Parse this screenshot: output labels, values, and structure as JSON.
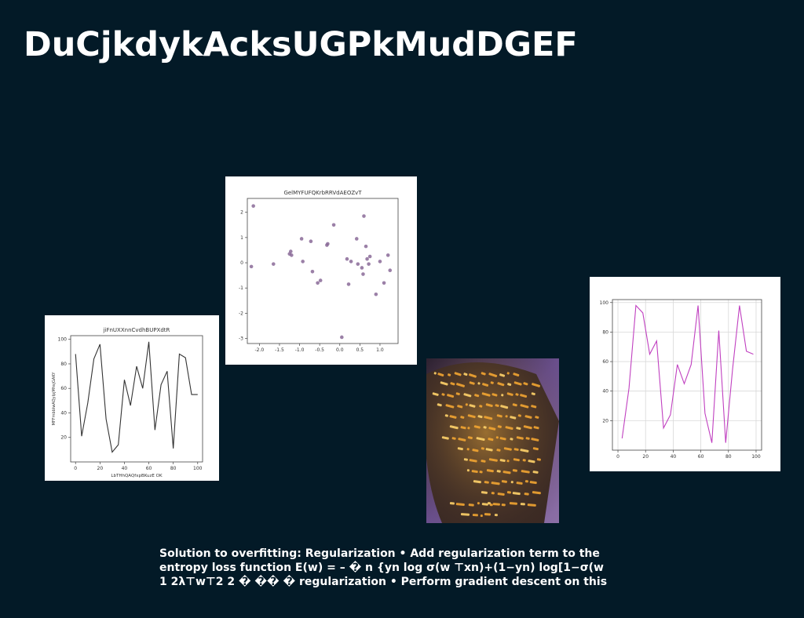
{
  "slide": {
    "title": "DuCjkdykAcksUGPkMudDGEF",
    "caption_lines": [
      "Solution to overfitting: Regularization • Add regularization term to the",
      "entropy loss function E(w) = – � n {yn log σ(w ⊤xn)+(1−yn) log[1−σ(w",
      "1 2λ⊤w⊤2 2 � �� � regularization • Perform gradient descent on this"
    ]
  },
  "chart_data": [
    {
      "type": "scatter",
      "title": "GelMYFUFQKrbRRVdAEOZvT",
      "xlabel": "",
      "ylabel": "",
      "xlim": [
        -2.3,
        1.45
      ],
      "ylim": [
        -3.2,
        2.55
      ],
      "xticks": [
        "-2.0",
        "-1.5",
        "-1.0",
        "-0.5",
        "0.0",
        "0.5",
        "1.0"
      ],
      "xtick_values": [
        -2.0,
        -1.5,
        -1.0,
        -0.5,
        0.0,
        0.5,
        1.0
      ],
      "yticks": [
        "2",
        "1",
        "0",
        "-1",
        "-2",
        "-3"
      ],
      "ytick_values": [
        2,
        1,
        0,
        -1,
        -2,
        -3
      ],
      "color": "#8a6a98",
      "x": [
        -2.15,
        -2.2,
        -1.65,
        -1.25,
        -1.22,
        -1.2,
        -0.95,
        -0.92,
        -0.72,
        -0.68,
        -0.55,
        -0.48,
        -0.32,
        -0.3,
        -0.15,
        0.05,
        0.18,
        0.22,
        0.28,
        0.42,
        0.45,
        0.55,
        0.58,
        0.6,
        0.65,
        0.68,
        0.72,
        0.75,
        0.9,
        1.0,
        1.1,
        1.2,
        1.25
      ],
      "y": [
        2.25,
        -0.15,
        -0.05,
        0.35,
        0.45,
        0.3,
        0.95,
        0.05,
        0.85,
        -0.35,
        -0.8,
        -0.7,
        0.7,
        0.75,
        1.5,
        -2.95,
        0.15,
        -0.85,
        0.05,
        0.95,
        -0.05,
        -0.2,
        -0.45,
        1.85,
        0.65,
        0.15,
        -0.05,
        0.25,
        -1.25,
        0.05,
        -0.8,
        0.3,
        -0.3
      ]
    },
    {
      "type": "line",
      "title": "jiFnUXXnnCvdhBUPXdtR",
      "xlabel": "LbTHhQAQfxpBKuzE OK",
      "ylabel": "MFFmbblwAQyIpjMhsjGAKY",
      "xlim": [
        -4,
        104
      ],
      "ylim": [
        0,
        103
      ],
      "xticks": [
        "0",
        "20",
        "40",
        "60",
        "80",
        "100"
      ],
      "xtick_values": [
        0,
        20,
        40,
        60,
        80,
        100
      ],
      "yticks": [
        "100",
        "80",
        "60",
        "40",
        "20"
      ],
      "ytick_values": [
        100,
        80,
        60,
        40,
        20
      ],
      "color": "#333333",
      "x": [
        0,
        5,
        10,
        15,
        20,
        25,
        30,
        35,
        40,
        45,
        50,
        55,
        60,
        65,
        70,
        75,
        80,
        85,
        90,
        95,
        100
      ],
      "y": [
        88,
        21,
        48,
        84,
        96,
        35,
        8,
        14,
        67,
        46,
        78,
        60,
        98,
        26,
        63,
        74,
        11,
        88,
        85,
        55,
        55
      ]
    },
    {
      "type": "line",
      "title": "",
      "xlabel": "",
      "ylabel": "",
      "grid": true,
      "xlim": [
        -4,
        104
      ],
      "ylim": [
        0,
        102
      ],
      "xticks": [
        "0",
        "20",
        "40",
        "60",
        "80",
        "100"
      ],
      "xtick_values": [
        0,
        20,
        40,
        60,
        80,
        100
      ],
      "yticks": [
        "100",
        "80",
        "60",
        "40",
        "20"
      ],
      "ytick_values": [
        100,
        80,
        60,
        40,
        20
      ],
      "color": "#c040c0",
      "x": [
        3,
        8,
        13,
        18,
        23,
        28,
        33,
        38,
        43,
        48,
        53,
        58,
        63,
        68,
        73,
        78,
        83,
        88,
        93,
        98
      ],
      "y": [
        8,
        42,
        98,
        93,
        65,
        74,
        15,
        24,
        58,
        45,
        58,
        98,
        25,
        5,
        81,
        5,
        55,
        98,
        67,
        65
      ]
    }
  ]
}
